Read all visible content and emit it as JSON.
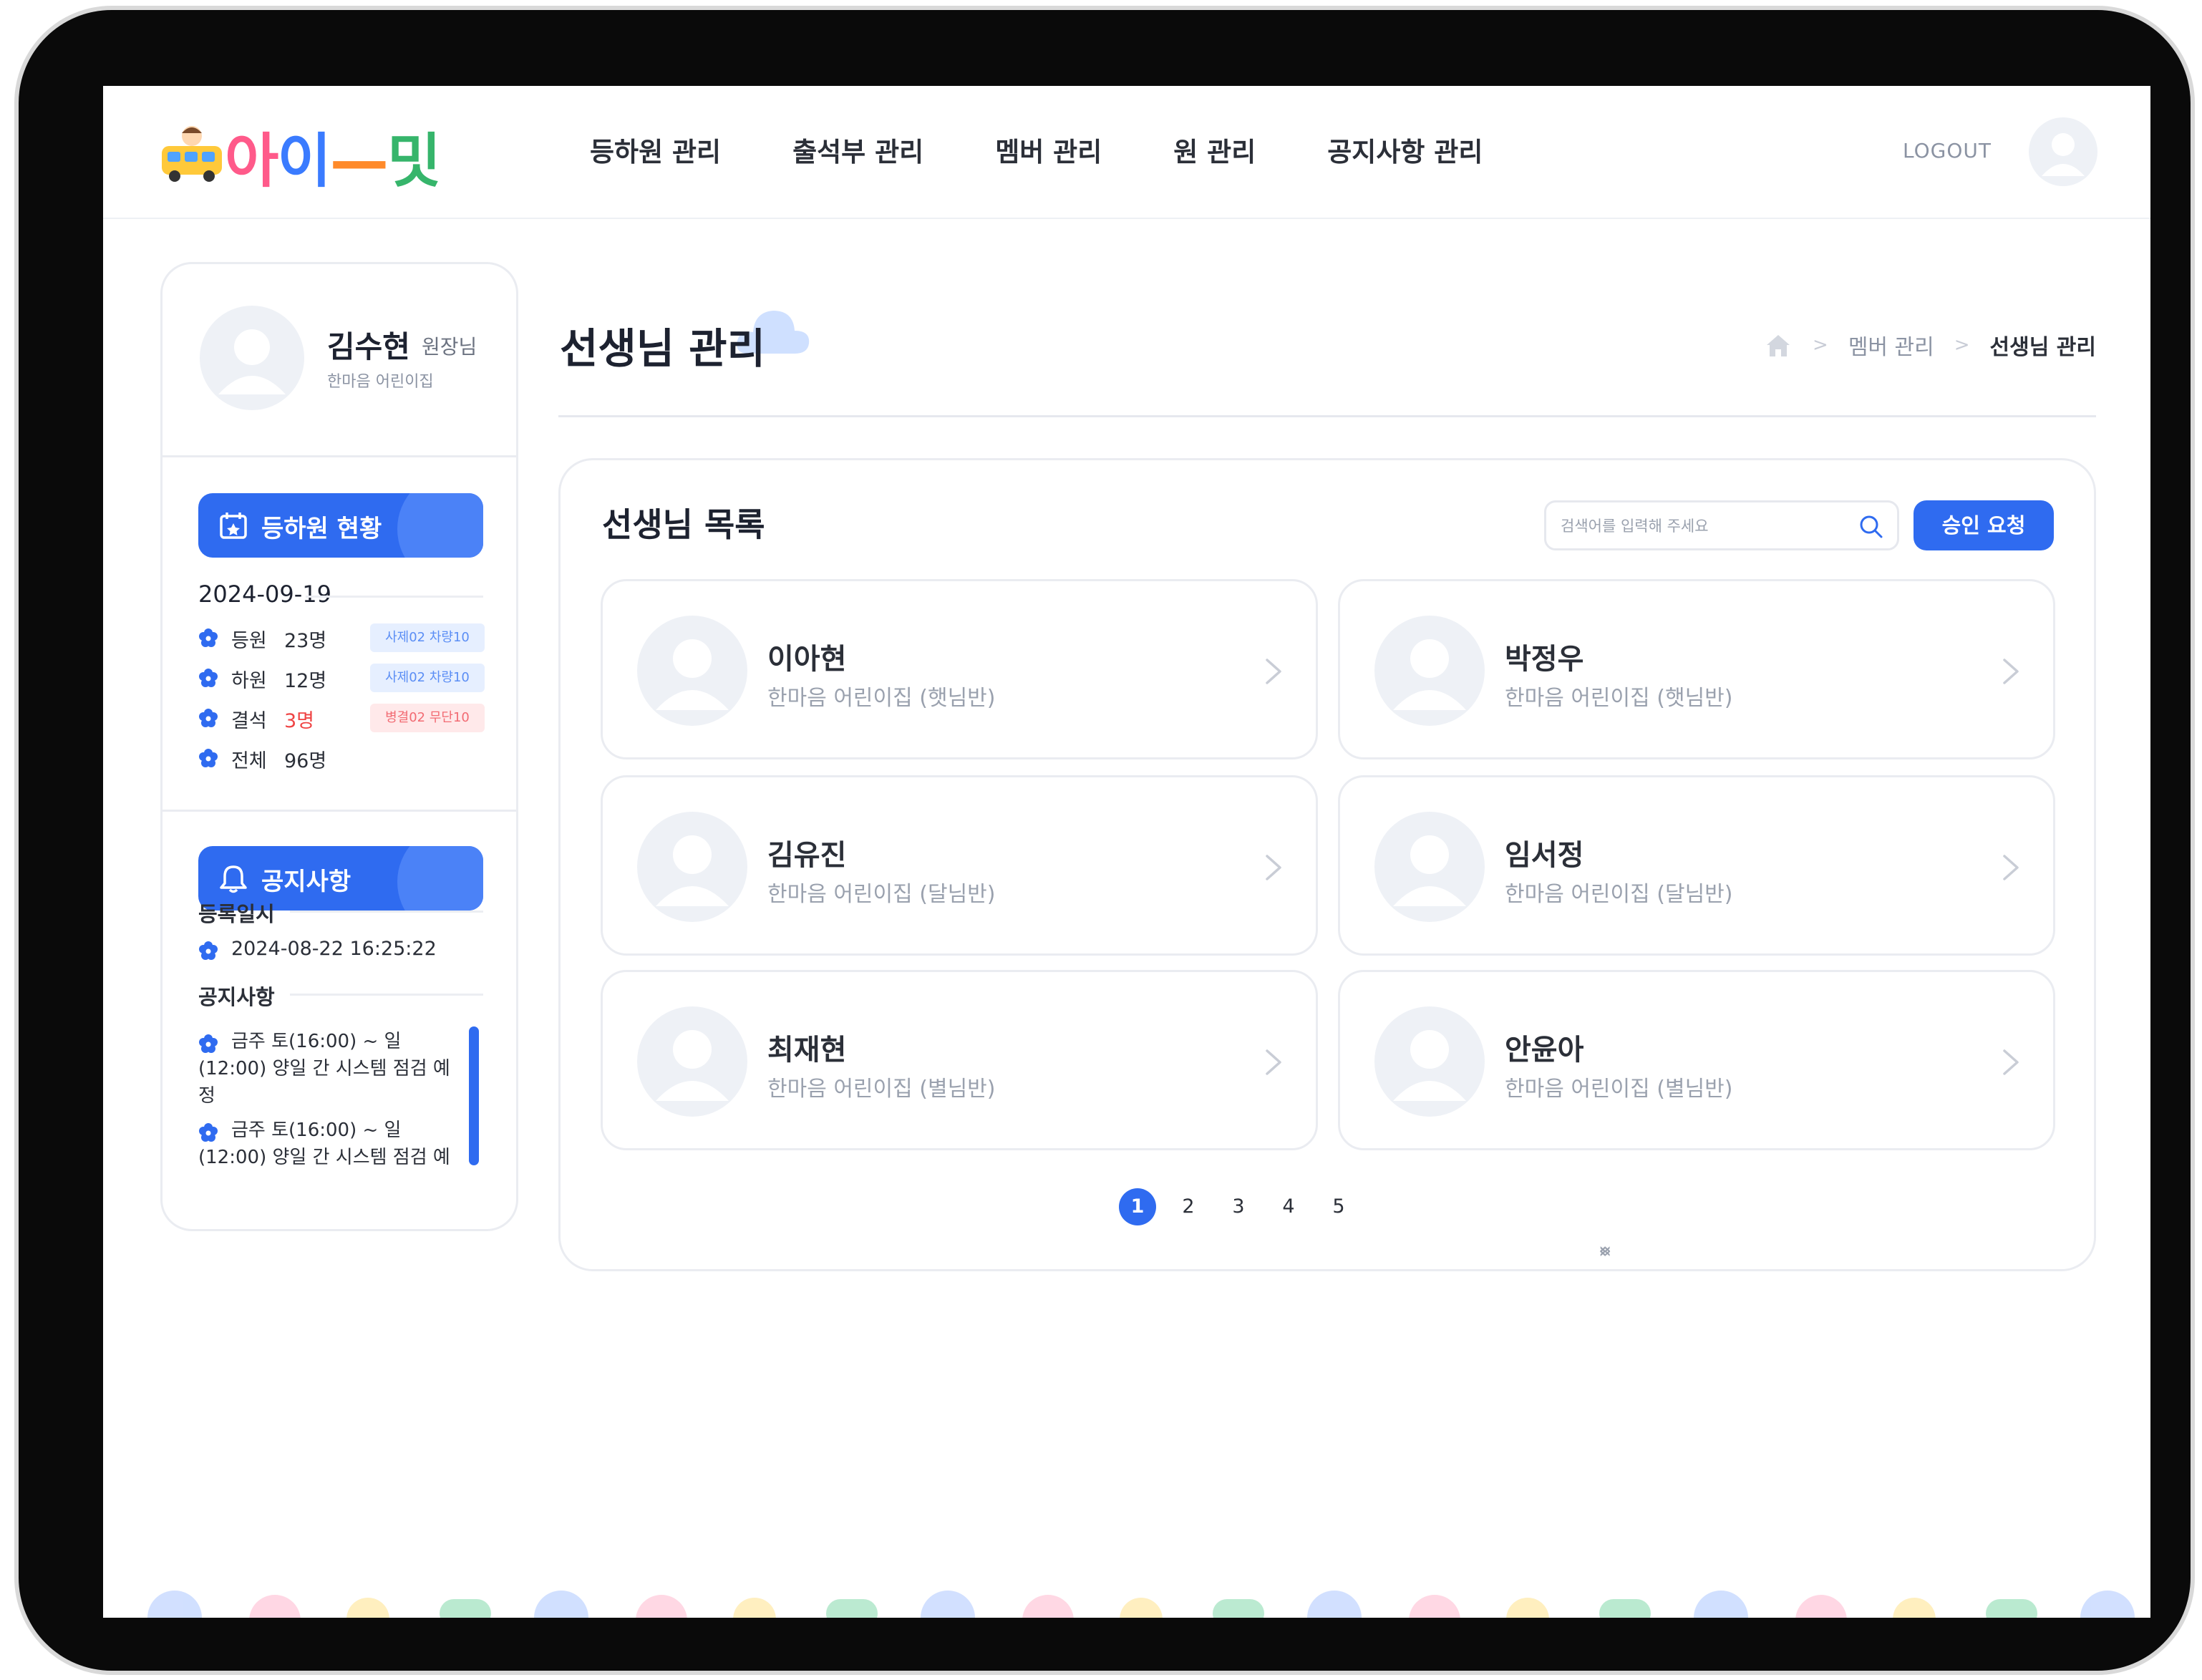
{
  "app": {
    "logo_text": [
      "아",
      "이",
      "—",
      "밋"
    ],
    "brand_colors": {
      "primary": "#2f6bf0",
      "alert": "#ef4444",
      "text": "#1d2230",
      "muted": "#9aa1ae"
    }
  },
  "header": {
    "nav": [
      "등하원 관리",
      "출석부 관리",
      "멤버 관리",
      "원 관리",
      "공지사항 관리"
    ],
    "logout": "LOGOUT",
    "avatar_icon": "user-avatar-icon"
  },
  "sidebar": {
    "profile": {
      "name": "김수현",
      "role": "원장님",
      "org": "한마음 어린이집"
    },
    "attendance": {
      "button": "등하원 현황",
      "date": "2024-09-19",
      "rows": [
        {
          "label": "등원",
          "count": "23명",
          "tag": "사제02 차량10",
          "alert": false
        },
        {
          "label": "하원",
          "count": "12명",
          "tag": "사제02 차량10",
          "alert": false
        },
        {
          "label": "결석",
          "count": "3명",
          "tag": "병결02 무단10",
          "alert": true
        },
        {
          "label": "전체",
          "count": "96명",
          "tag": "",
          "alert": false
        }
      ]
    },
    "notice": {
      "button": "공지사항",
      "date_label": "등록일시",
      "date": "2024-08-22 16:25:22",
      "list_label": "공지사항",
      "items": [
        "금주 토(16:00) ~ 일(12:00) 양일 간 시스템 점검 예정",
        "금주 토(16:00) ~ 일(12:00) 양일 간 시스템 점검 예"
      ]
    }
  },
  "main": {
    "title": "선생님 관리",
    "breadcrumb": [
      "멤버 관리",
      "선생님 관리"
    ],
    "panel_title": "선생님 목록",
    "search_placeholder": "검색어를 입력해 주세요",
    "approve_button": "승인 요청",
    "teachers": [
      {
        "name": "이아현",
        "org": "한마음 어린이집 (햇님반)"
      },
      {
        "name": "박정우",
        "org": "한마음 어린이집 (햇님반)"
      },
      {
        "name": "김유진",
        "org": "한마음 어린이집 (달님반)"
      },
      {
        "name": "임서정",
        "org": "한마음 어린이집 (달님반)"
      },
      {
        "name": "최재현",
        "org": "한마음 어린이집 (별님반)"
      },
      {
        "name": "안윤아",
        "org": "한마음 어린이집 (별님반)"
      }
    ],
    "pagination": {
      "pages": [
        "1",
        "2",
        "3",
        "4",
        "5"
      ],
      "current": "1"
    }
  }
}
